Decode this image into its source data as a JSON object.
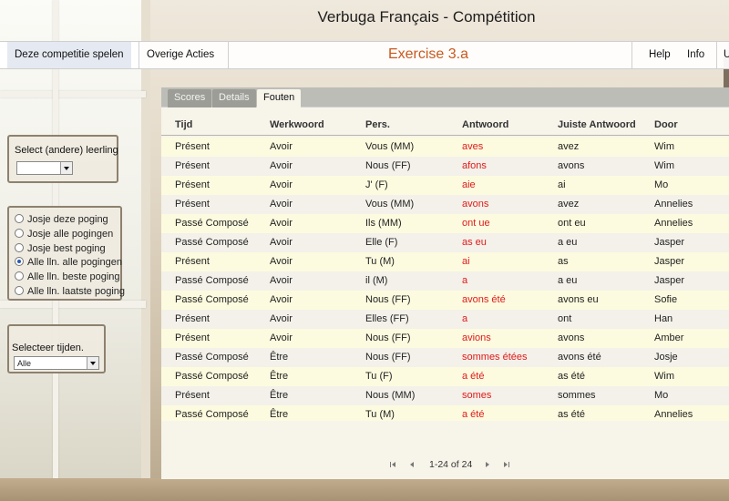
{
  "app": {
    "title": "Verbuga Français - Compétition"
  },
  "toolbar": {
    "play_label": "Deze competitie spelen",
    "other_actions_label": "Overige Acties",
    "exercise_title": "Exercise 3.a",
    "help_label": "Help",
    "info_label": "Info",
    "overflow_label": "Ui"
  },
  "student_select": {
    "label": "Select (andere) leerling",
    "value": ""
  },
  "attempt_filter": {
    "options": [
      {
        "label": "Josje deze poging",
        "checked": false
      },
      {
        "label": "Josje alle pogingen",
        "checked": false
      },
      {
        "label": "Josje best poging",
        "checked": false
      },
      {
        "label": "Alle lln. alle pogingen",
        "checked": true
      },
      {
        "label": "Alle lln. beste poging",
        "checked": false
      },
      {
        "label": "Alle lln. laatste poging",
        "checked": false
      }
    ]
  },
  "tense_select": {
    "label": "Selecteer tijden.",
    "value": "Alle"
  },
  "tabs": [
    "Scores",
    "Details",
    "Fouten"
  ],
  "active_tab": "Fouten",
  "grid": {
    "columns": [
      "Tijd",
      "Werkwoord",
      "Pers.",
      "Antwoord",
      "Juiste Antwoord",
      "Door"
    ],
    "rows": [
      [
        "Présent",
        "Avoir",
        "Vous (MM)",
        "aves",
        "avez",
        "Wim"
      ],
      [
        "Présent",
        "Avoir",
        "Nous (FF)",
        "afons",
        "avons",
        "Wim"
      ],
      [
        "Présent",
        "Avoir",
        "J' (F)",
        "aie",
        "ai",
        "Mo"
      ],
      [
        "Présent",
        "Avoir",
        "Vous (MM)",
        "avons",
        "avez",
        "Annelies"
      ],
      [
        "Passé Composé",
        "Avoir",
        "Ils (MM)",
        "ont ue",
        "ont eu",
        "Annelies"
      ],
      [
        "Passé Composé",
        "Avoir",
        "Elle (F)",
        "as eu",
        "a eu",
        "Jasper"
      ],
      [
        "Présent",
        "Avoir",
        "Tu (M)",
        "ai",
        "as",
        "Jasper"
      ],
      [
        "Passé Composé",
        "Avoir",
        "il (M)",
        "a",
        "a eu",
        "Jasper"
      ],
      [
        "Passé Composé",
        "Avoir",
        "Nous (FF)",
        "avons été",
        "avons eu",
        "Sofie"
      ],
      [
        "Présent",
        "Avoir",
        "Elles (FF)",
        "a",
        "ont",
        "Han"
      ],
      [
        "Présent",
        "Avoir",
        "Nous (FF)",
        "avions",
        "avons",
        "Amber"
      ],
      [
        "Passé Composé",
        "Être",
        "Nous (FF)",
        "sommes étées",
        "avons été",
        "Josje"
      ],
      [
        "Passé Composé",
        "Être",
        "Tu (F)",
        "a été",
        "as été",
        "Wim"
      ],
      [
        "Présent",
        "Être",
        "Nous (MM)",
        "somes",
        "sommes",
        "Mo"
      ],
      [
        "Passé Composé",
        "Être",
        "Tu (M)",
        "a été",
        "as été",
        "Annelies"
      ]
    ]
  },
  "pager": {
    "text": "1-24 of 24"
  },
  "colors": {
    "accent": "#c85a1e",
    "wrong_answer": "#e01a1a",
    "row_odd": "#fcfbdf",
    "row_even": "#f3f1e9"
  }
}
